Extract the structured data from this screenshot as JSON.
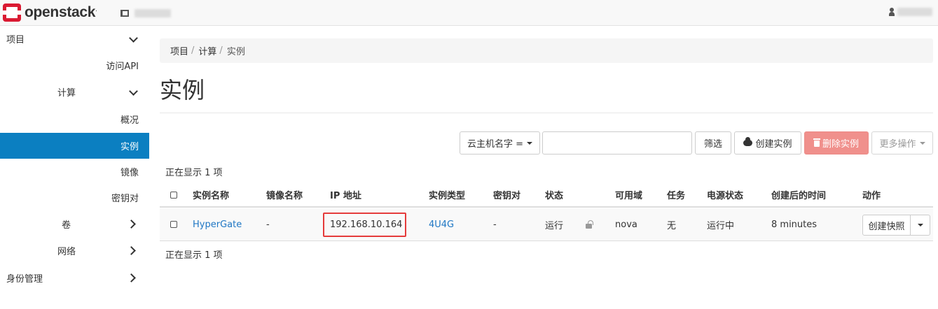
{
  "brand": {
    "name": "openstack",
    "mark": "."
  },
  "sidebar": {
    "project": "项目",
    "api_access": "访问API",
    "compute": "计算",
    "overview": "概况",
    "instances": "实例",
    "images": "镜像",
    "key_pairs": "密钥对",
    "volumes": "卷",
    "network": "网络",
    "identity": "身份管理"
  },
  "breadcrumb": {
    "items": [
      "项目",
      "计算",
      "实例"
    ],
    "separator": "/"
  },
  "page_title": "实例",
  "toolbar": {
    "filter_field": "云主机名字 =",
    "search_value": "",
    "filter_label": "筛选",
    "create_label": "创建实例",
    "delete_label": "删除实例",
    "more_label": "更多操作"
  },
  "count_text_top": "正在显示 1 项",
  "count_text_bottom": "正在显示 1 项",
  "table": {
    "headers": {
      "name": "实例名称",
      "image": "镜像名称",
      "ip": "IP 地址",
      "flavor": "实例类型",
      "keypair": "密钥对",
      "status": "状态",
      "az": "可用域",
      "task": "任务",
      "power": "电源状态",
      "age": "创建后的时间",
      "actions": "动作"
    },
    "rows": [
      {
        "name": "HyperGate",
        "image": "-",
        "ip": "192.168.10.164",
        "flavor": "4U4G",
        "keypair": "-",
        "status": "运行",
        "az": "nova",
        "task": "无",
        "power": "运行中",
        "age": "8 minutes",
        "action": "创建快照"
      }
    ]
  },
  "colors": {
    "accent": "#0b7fc1",
    "danger": "#f0908c",
    "link": "#1f77c4",
    "highlight": "#e53b3b"
  }
}
